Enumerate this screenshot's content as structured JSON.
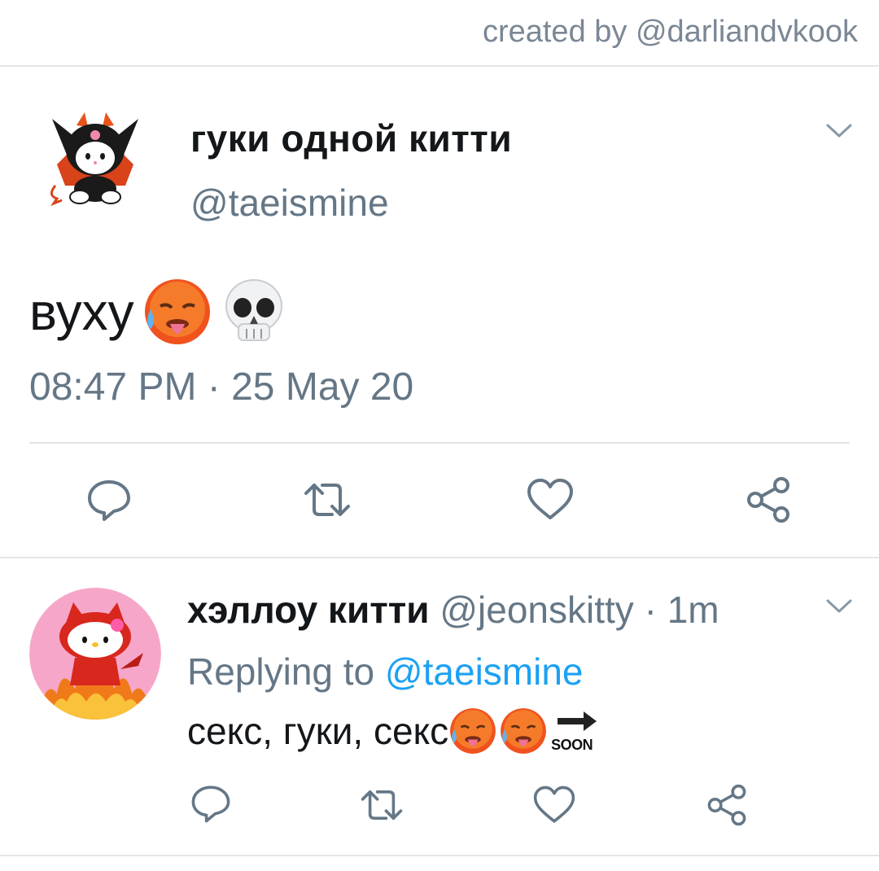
{
  "credit": "created by @darliandvkook",
  "tweet": {
    "name": "гуки одной китти",
    "handle": "@taeismine",
    "text": "вуху",
    "emojis": [
      "hot-face-emoji",
      "skull-emoji"
    ],
    "timestamp": "08:47 PM · 25 May 20"
  },
  "reply": {
    "name": "хэллоу китти",
    "handle": "@jeonskitty",
    "separator": " · ",
    "age": "1m",
    "replying_label": "Replying to ",
    "replying_handle": "@taeismine",
    "text": "секс, гуки, секс",
    "emojis": [
      "hot-face-emoji",
      "hot-face-emoji",
      "soon-arrow-emoji"
    ],
    "soon_label": "SOON"
  },
  "icons": {
    "actions": [
      "reply-icon",
      "retweet-icon",
      "like-icon",
      "share-icon"
    ],
    "menu": "chevron-down-icon"
  },
  "colors": {
    "text": "#14171a",
    "secondary": "#657786",
    "link": "#1da1f2",
    "divider": "#e3e7eb"
  }
}
